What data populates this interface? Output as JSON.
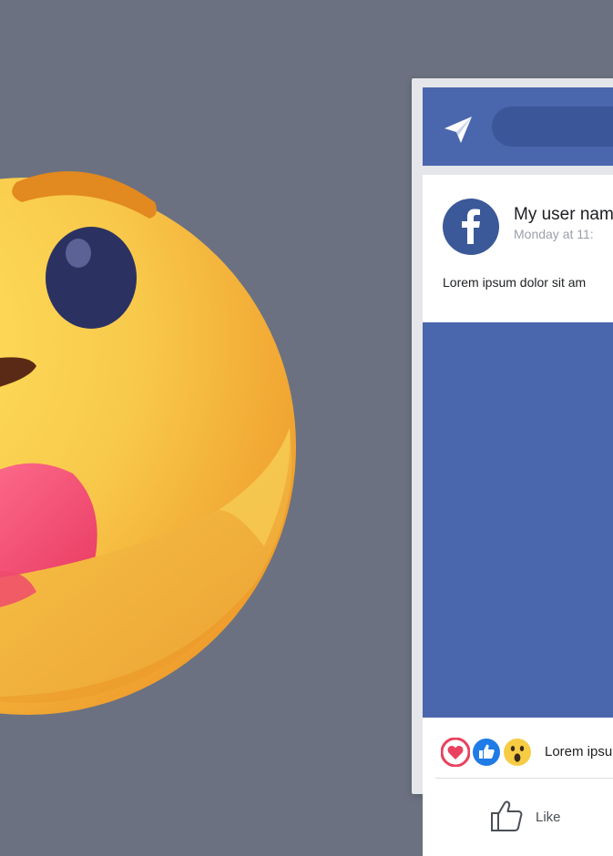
{
  "post": {
    "user_name": "My user nam",
    "timestamp": "Monday at 11:",
    "text": "Lorem ipsum dolor sit am",
    "reaction_text": "Lorem ipsu",
    "like_label": "Like"
  },
  "colors": {
    "background": "#6b7180",
    "facebook_blue": "#4a66ad",
    "facebook_dark_blue": "#3b5998",
    "emoji_yellow": "#f7c843"
  },
  "icons": {
    "emoji": "care-reaction-emoji",
    "send": "send-icon",
    "avatar_logo": "facebook-logo-icon",
    "reactions": [
      "love-reaction-icon",
      "like-reaction-icon",
      "wow-reaction-icon"
    ],
    "like_button": "thumbs-up-icon"
  }
}
